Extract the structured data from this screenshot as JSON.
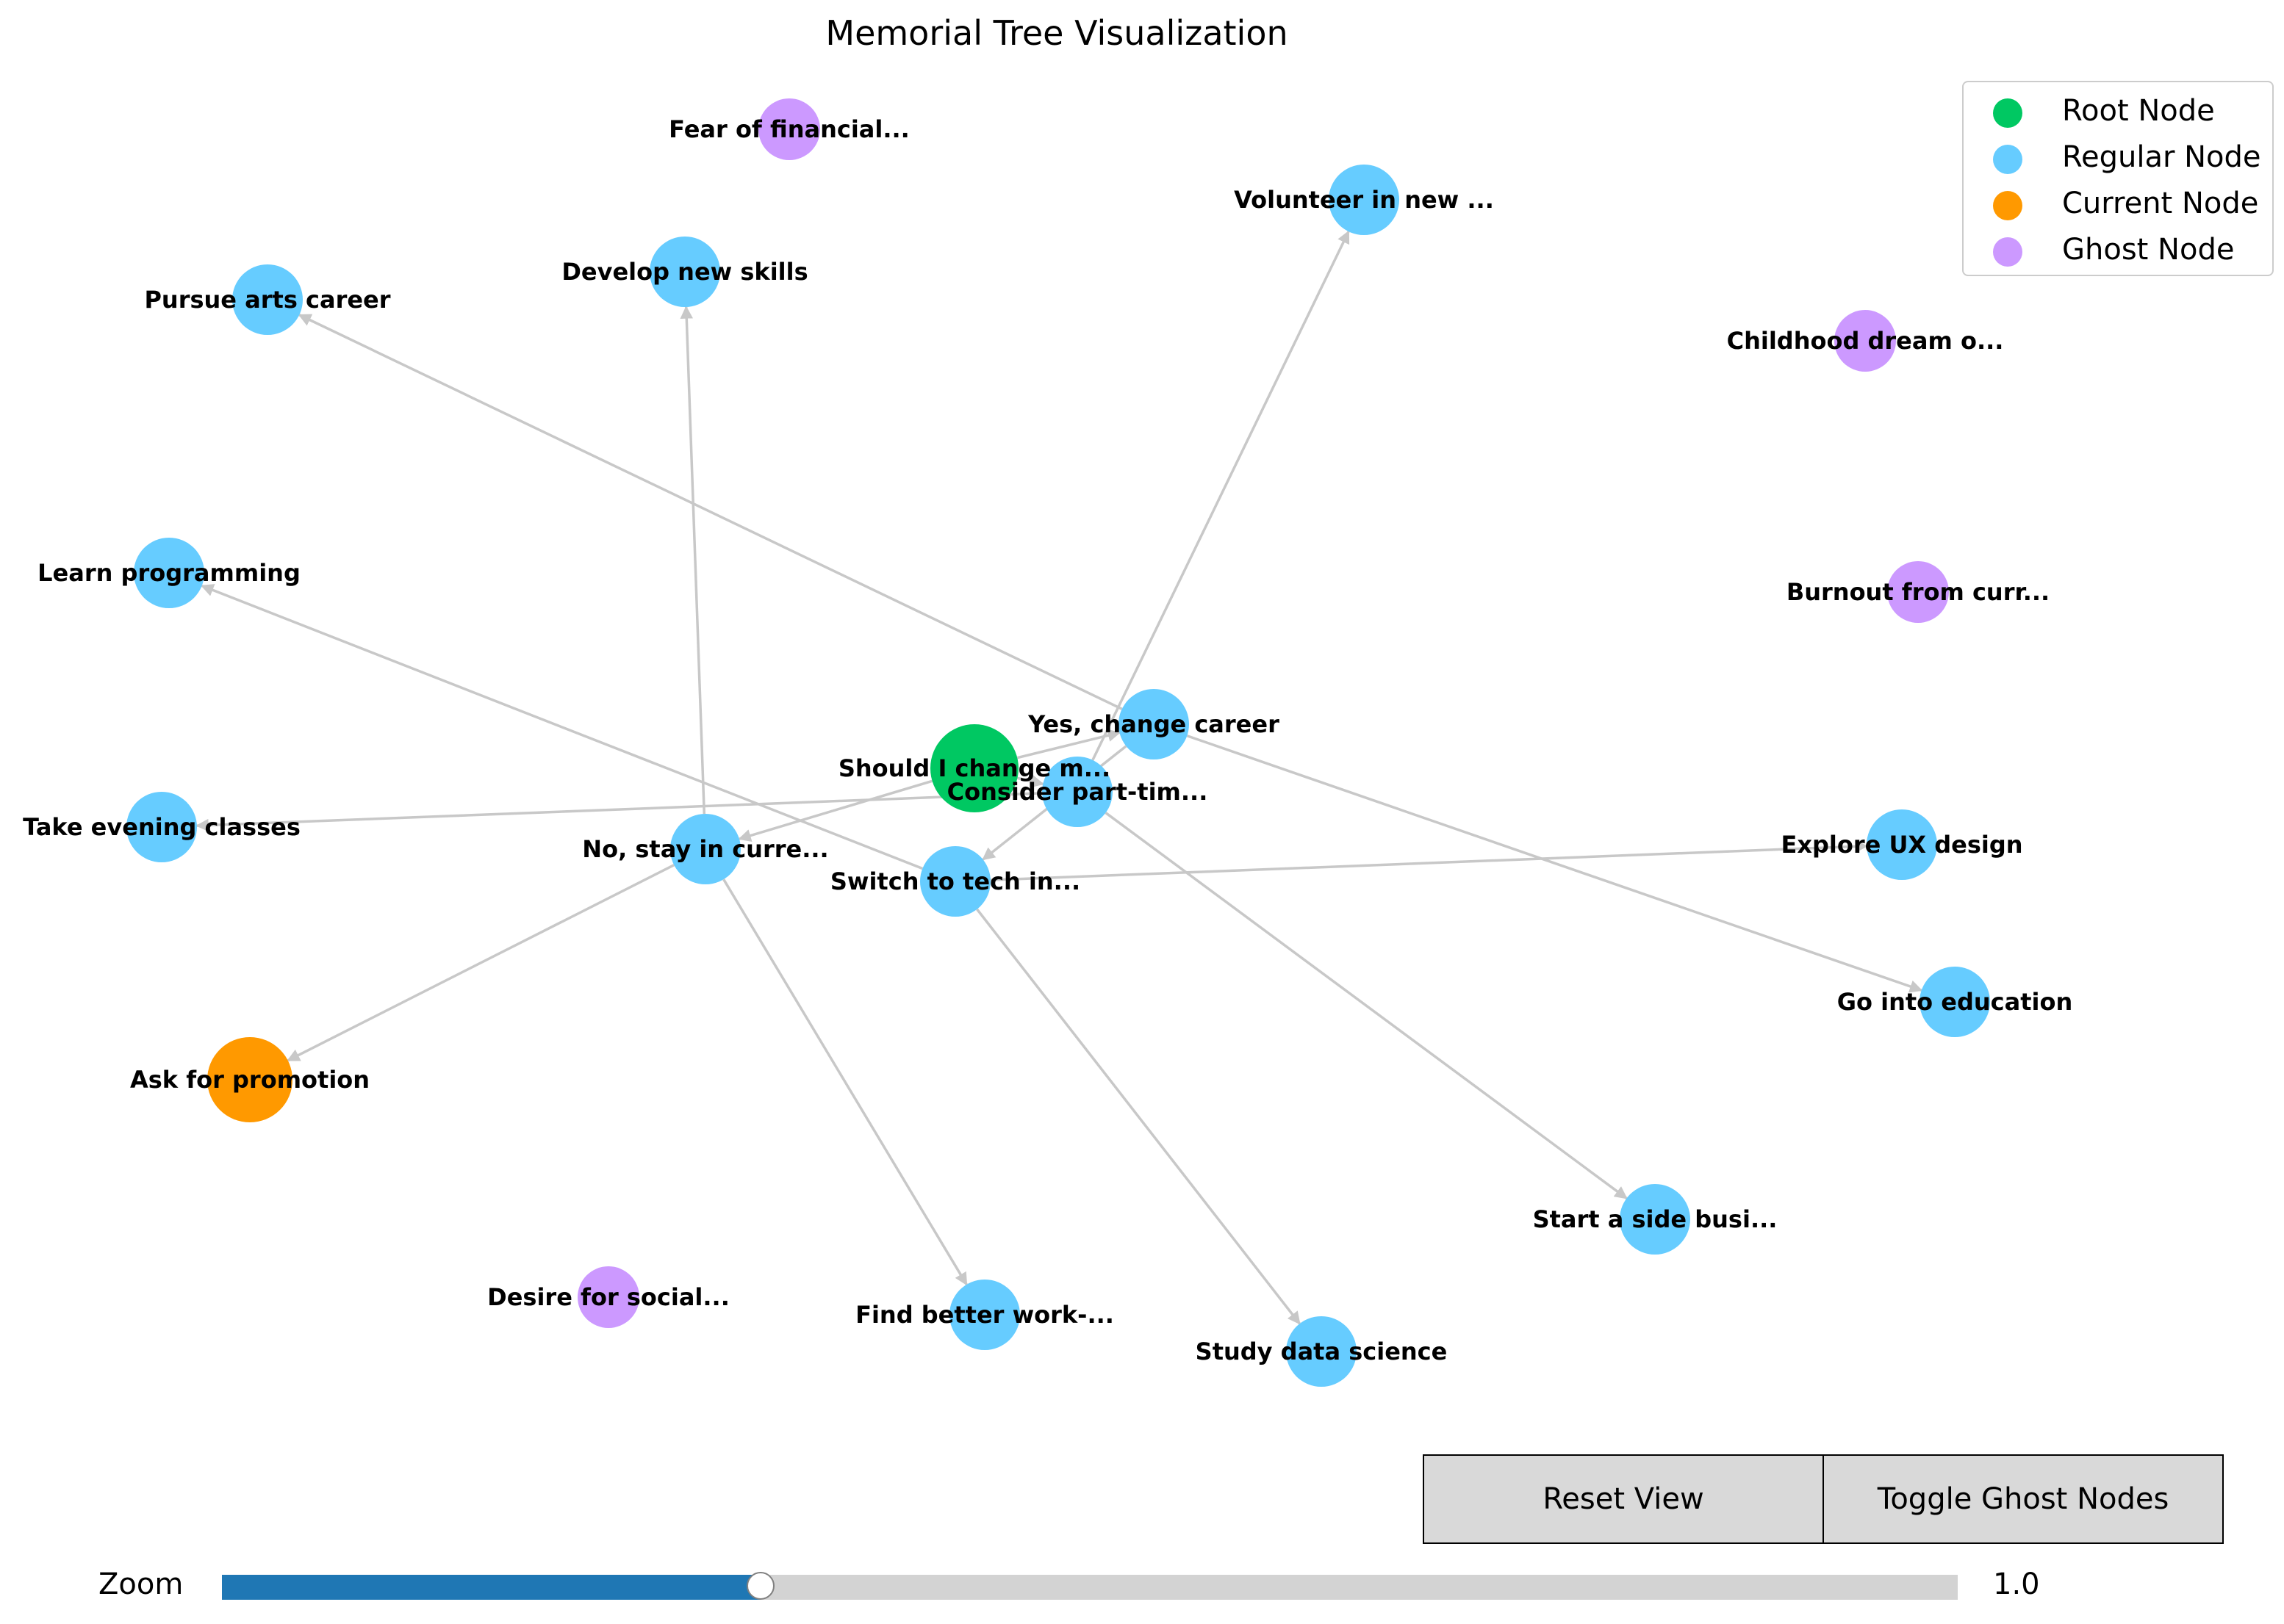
{
  "title": "Memorial Tree Visualization",
  "colors": {
    "root": "#00c862",
    "regular": "#66ccff",
    "current": "#ff9900",
    "ghost": "#cc99ff",
    "edge": "#c8c8c8"
  },
  "legend": [
    {
      "label": "Root Node",
      "kind": "root"
    },
    {
      "label": "Regular Node",
      "kind": "regular"
    },
    {
      "label": "Current Node",
      "kind": "current"
    },
    {
      "label": "Ghost Node",
      "kind": "ghost"
    }
  ],
  "nodes": [
    {
      "id": "root",
      "label": "Should I change m...",
      "kind": "root"
    },
    {
      "id": "yes",
      "label": "Yes, change career",
      "kind": "regular"
    },
    {
      "id": "no",
      "label": "No, stay in curre...",
      "kind": "regular"
    },
    {
      "id": "parttime",
      "label": "Consider part-tim...",
      "kind": "regular"
    },
    {
      "id": "tech",
      "label": "Switch to tech in...",
      "kind": "regular"
    },
    {
      "id": "arts",
      "label": "Pursue arts career",
      "kind": "regular"
    },
    {
      "id": "education",
      "label": "Go into education",
      "kind": "regular"
    },
    {
      "id": "skills",
      "label": "Develop new skills",
      "kind": "regular"
    },
    {
      "id": "promotion",
      "label": "Ask for promotion",
      "kind": "current"
    },
    {
      "id": "better",
      "label": "Find better work-...",
      "kind": "regular"
    },
    {
      "id": "evening",
      "label": "Take evening classes",
      "kind": "regular"
    },
    {
      "id": "volunteer",
      "label": "Volunteer in new ...",
      "kind": "regular"
    },
    {
      "id": "sidebiz",
      "label": "Start a side busi...",
      "kind": "regular"
    },
    {
      "id": "programming",
      "label": "Learn programming",
      "kind": "regular"
    },
    {
      "id": "datasci",
      "label": "Study data science",
      "kind": "regular"
    },
    {
      "id": "ux",
      "label": "Explore UX design",
      "kind": "regular"
    },
    {
      "id": "g_fear",
      "label": "Fear of financial...",
      "kind": "ghost"
    },
    {
      "id": "g_child",
      "label": "Childhood dream o...",
      "kind": "ghost"
    },
    {
      "id": "g_burnout",
      "label": "Burnout from curr...",
      "kind": "ghost"
    },
    {
      "id": "g_social",
      "label": "Desire for social...",
      "kind": "ghost"
    }
  ],
  "edges": [
    [
      "root",
      "yes"
    ],
    [
      "root",
      "no"
    ],
    [
      "root",
      "parttime"
    ],
    [
      "yes",
      "tech"
    ],
    [
      "yes",
      "arts"
    ],
    [
      "yes",
      "education"
    ],
    [
      "no",
      "skills"
    ],
    [
      "no",
      "promotion"
    ],
    [
      "no",
      "better"
    ],
    [
      "parttime",
      "evening"
    ],
    [
      "parttime",
      "volunteer"
    ],
    [
      "parttime",
      "sidebiz"
    ],
    [
      "tech",
      "programming"
    ],
    [
      "tech",
      "datasci"
    ],
    [
      "tech",
      "ux"
    ]
  ],
  "buttons": {
    "reset": "Reset View",
    "toggle_ghost": "Toggle Ghost Nodes"
  },
  "zoom": {
    "label": "Zoom",
    "value_text": "1.0",
    "value": 1.0,
    "min": 0.1,
    "max": 3.0
  }
}
